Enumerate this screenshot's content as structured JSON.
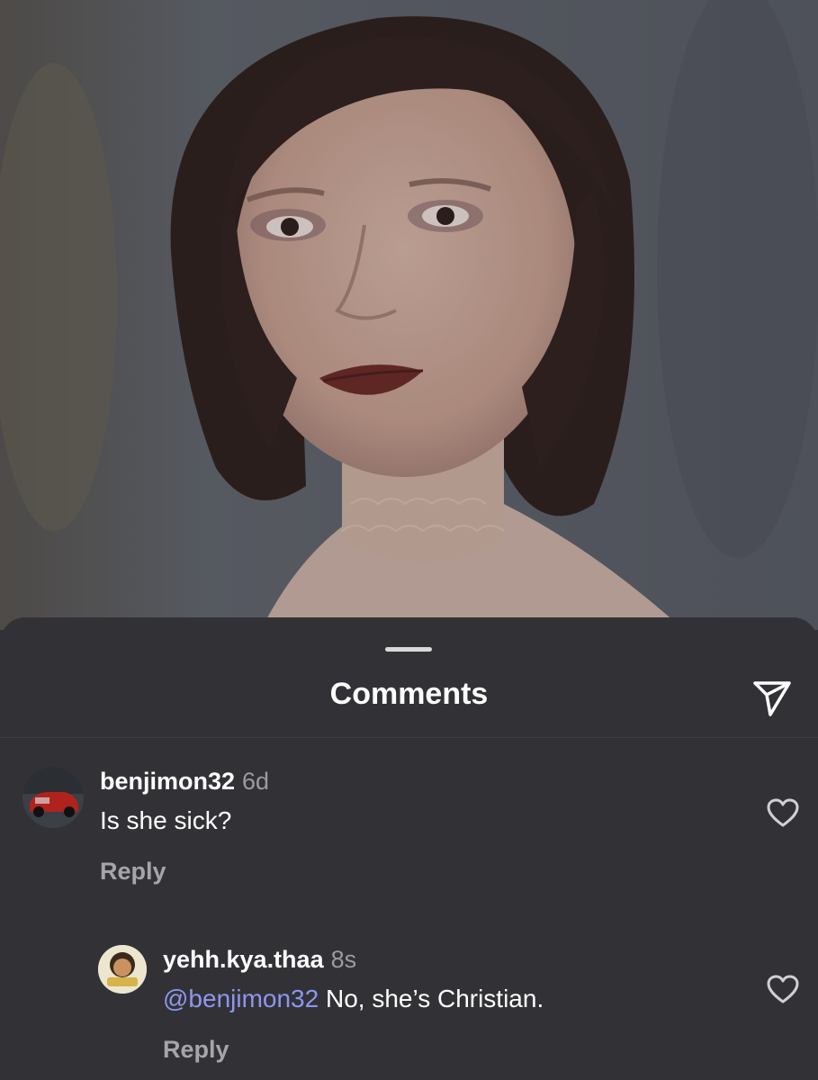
{
  "sheet": {
    "title": "Comments"
  },
  "comments": [
    {
      "username": "benjimon32",
      "time": "6d",
      "text": "Is she sick?",
      "reply_label": "Reply"
    },
    {
      "username": "yehh.kya.thaa",
      "time": "8s",
      "mention": "@benjimon32",
      "text": " No, she’s Christian.",
      "reply_label": "Reply"
    }
  ],
  "icons": {
    "share": "send-icon",
    "like": "heart-outline-icon"
  },
  "colors": {
    "background": "#323236",
    "mention": "#8e96ef",
    "secondary_text": "#9b9ba1"
  }
}
